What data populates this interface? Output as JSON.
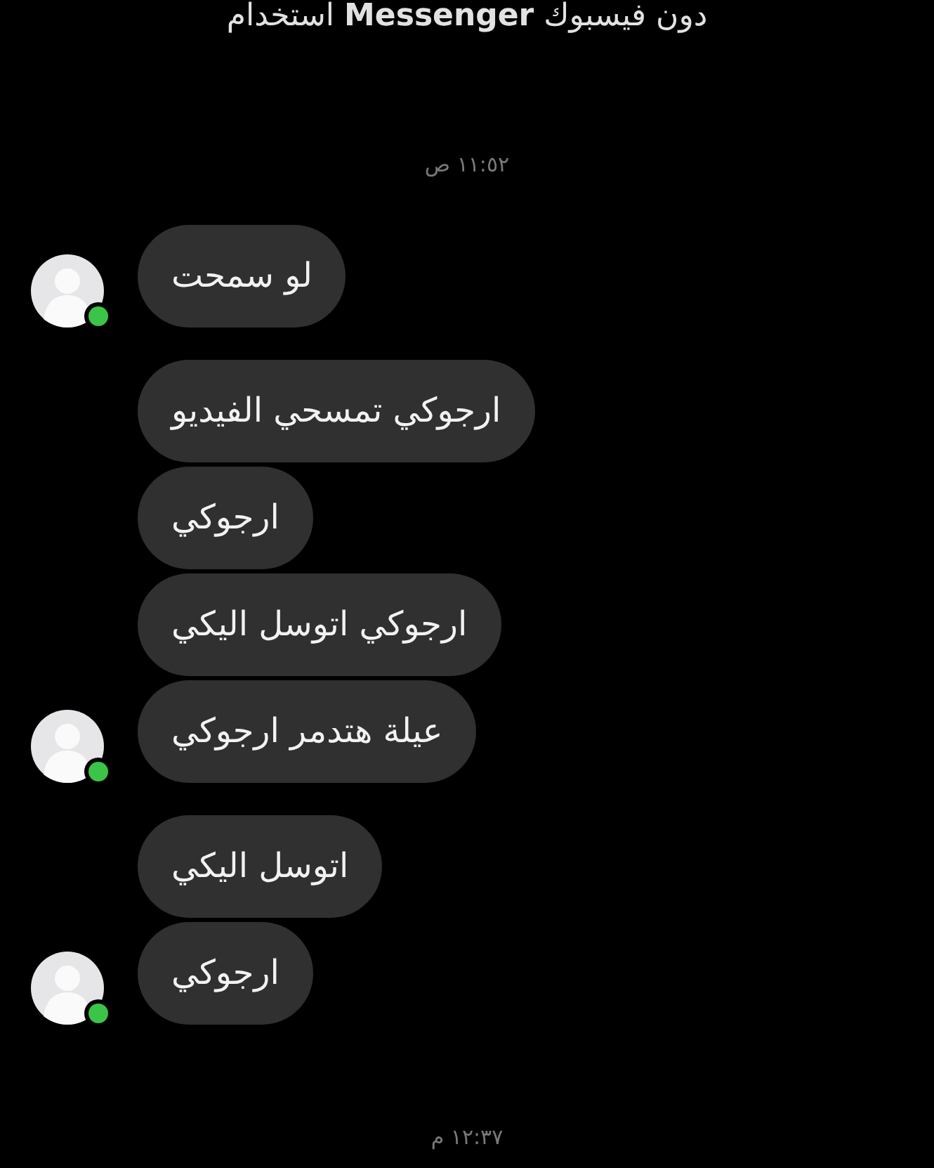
{
  "banner": {
    "text": "دون فيسبوك **Messenger** استخدام"
  },
  "thread": [
    {
      "kind": "timestamp",
      "text": "١١:٥٢ ص"
    },
    {
      "kind": "group",
      "online": true,
      "messages": [
        "لو سمحت"
      ]
    },
    {
      "kind": "group",
      "online": true,
      "messages": [
        "ارجوكي تمسحي الفيديو",
        "ارجوكي",
        "ارجوكي اتوسل اليكي",
        "عيلة هتدمر ارجوكي"
      ]
    },
    {
      "kind": "group",
      "online": true,
      "messages": [
        "اتوسل اليكي",
        "ارجوكي"
      ]
    },
    {
      "kind": "timestamp",
      "text": "١٢:٣٧ م"
    }
  ]
}
